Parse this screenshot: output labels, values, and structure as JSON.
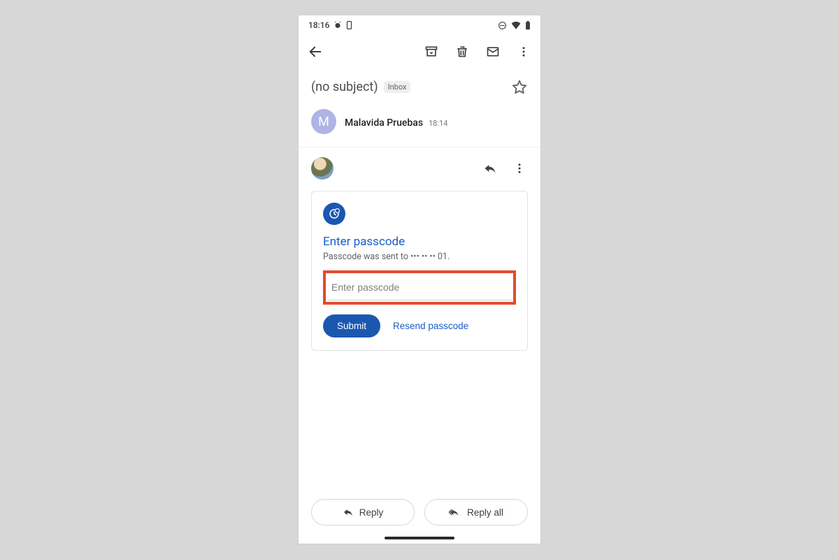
{
  "statusbar": {
    "time": "18:16"
  },
  "subject": {
    "text": "(no subject)",
    "label": "Inbox"
  },
  "sender": {
    "initial": "M",
    "name": "Malavida Pruebas",
    "time": "18:14"
  },
  "card": {
    "title": "Enter passcode",
    "subtitle": "Passcode was sent to ••• •• •• 01.",
    "input_placeholder": "Enter passcode",
    "submit_label": "Submit",
    "resend_label": "Resend passcode"
  },
  "bottom": {
    "reply_label": "Reply",
    "reply_all_label": "Reply all"
  }
}
